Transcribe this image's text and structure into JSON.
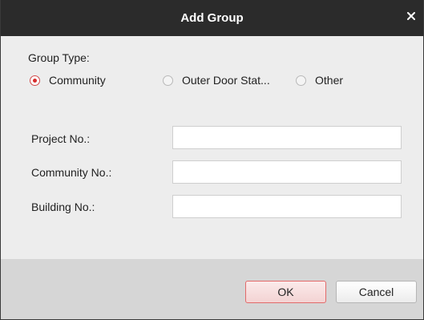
{
  "dialog": {
    "title": "Add Group",
    "close_icon": "close-icon"
  },
  "group_type": {
    "label": "Group Type:",
    "options": [
      {
        "label": "Community",
        "checked": true
      },
      {
        "label": "Outer Door Stat...",
        "checked": false
      },
      {
        "label": "Other",
        "checked": false
      }
    ]
  },
  "fields": [
    {
      "label": "Project No.:",
      "value": ""
    },
    {
      "label": "Community No.:",
      "value": ""
    },
    {
      "label": "Building No.:",
      "value": ""
    }
  ],
  "buttons": {
    "ok": "OK",
    "cancel": "Cancel"
  },
  "colors": {
    "titlebar": "#2b2b2b",
    "accent": "#d72c2c",
    "body": "#ededed",
    "footer": "#d6d6d6"
  }
}
